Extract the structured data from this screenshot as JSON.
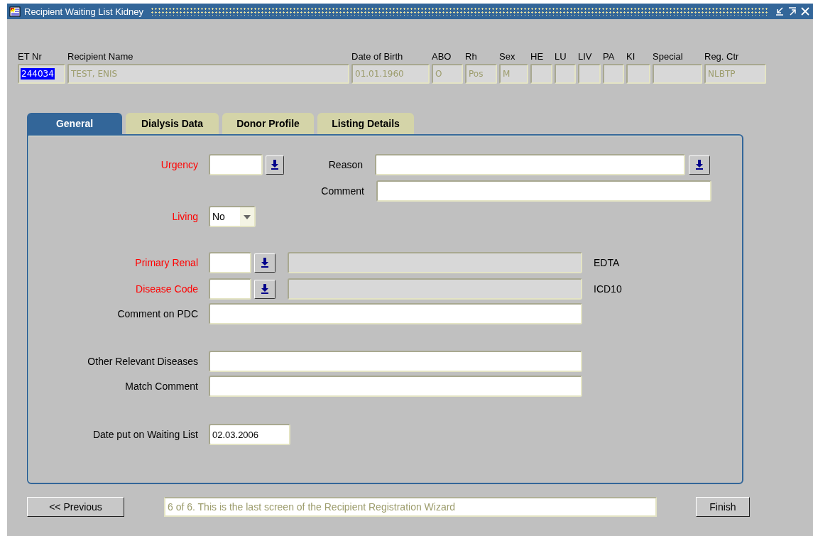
{
  "window": {
    "title": "Recipient Waiting List Kidney"
  },
  "header": {
    "fields": [
      {
        "label": "ET Nr",
        "value": "244034",
        "highlighted": true
      },
      {
        "label": "Recipient Name",
        "value": "TEST, ENIS",
        "highlighted": false
      },
      {
        "label": "Date of Birth",
        "value": "01.01.1960",
        "highlighted": false
      },
      {
        "label": "ABO",
        "value": "O",
        "highlighted": false
      },
      {
        "label": "Rh",
        "value": "Pos",
        "highlighted": false
      },
      {
        "label": "Sex",
        "value": "M",
        "highlighted": false
      },
      {
        "label": "HE"
      },
      {
        "label": "LU"
      },
      {
        "label": "LIV"
      },
      {
        "label": "PA"
      },
      {
        "label": "KI"
      },
      {
        "label": "Special"
      },
      {
        "label": "Reg. Ctr",
        "value": "NLBTP",
        "highlighted": false
      }
    ]
  },
  "tabs": [
    {
      "label": "General",
      "selected": true
    },
    {
      "label": "Dialysis Data",
      "selected": false
    },
    {
      "label": "Donor Profile",
      "selected": false
    },
    {
      "label": "Listing Details",
      "selected": false
    }
  ],
  "form": {
    "urgency": {
      "label": "Urgency",
      "required": true
    },
    "reason": {
      "label": "Reason",
      "required": false
    },
    "comment": {
      "label": "Comment",
      "required": false
    },
    "living": {
      "label": "Living",
      "required": true,
      "value": "No"
    },
    "primary_renal": {
      "label": "Primary Renal",
      "required": true,
      "suffix": "EDTA"
    },
    "disease_code": {
      "label": "Disease Code",
      "required": true,
      "suffix": "ICD10"
    },
    "comment_on_pdc": {
      "label": "Comment on PDC",
      "required": false
    },
    "other_relevant_diseases": {
      "label": "Other Relevant Diseases",
      "required": false
    },
    "match_comment": {
      "label": "Match Comment",
      "required": false
    },
    "date_put_on_waiting_list": {
      "label": "Date put on Waiting List",
      "required": false,
      "value": "02.03.2006"
    }
  },
  "footer": {
    "previous_button": "<< Previous",
    "message": "6 of 6. This is the last screen of the Recipient Registration Wizard",
    "finish_button": "Finish"
  }
}
